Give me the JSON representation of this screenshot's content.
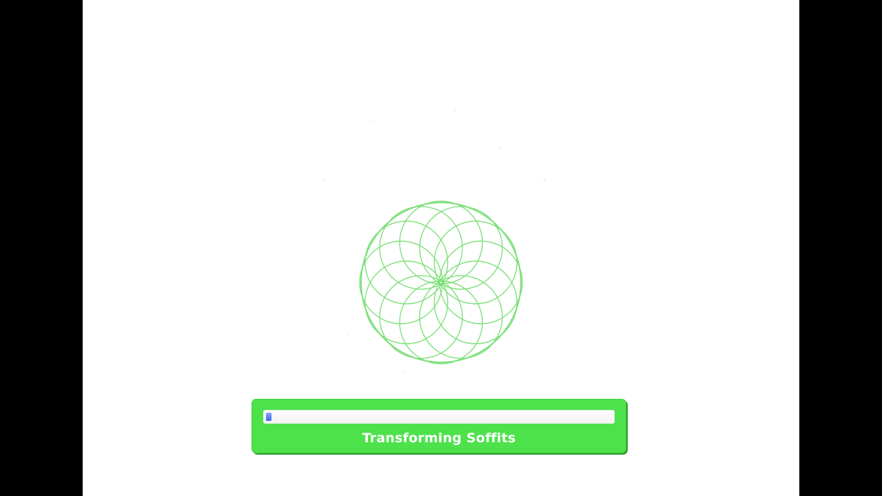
{
  "loader": {
    "status_text": "Transforming Soffits",
    "progress_fraction": 0.015
  },
  "colors": {
    "letterbox": "#000000",
    "background": "#ffffff",
    "panel_green": "#4de24c",
    "spiro_green": "#7ee07a",
    "progress_blue": "#3b63e6"
  },
  "icons": {
    "loading_animation": "spirograph-icon"
  }
}
